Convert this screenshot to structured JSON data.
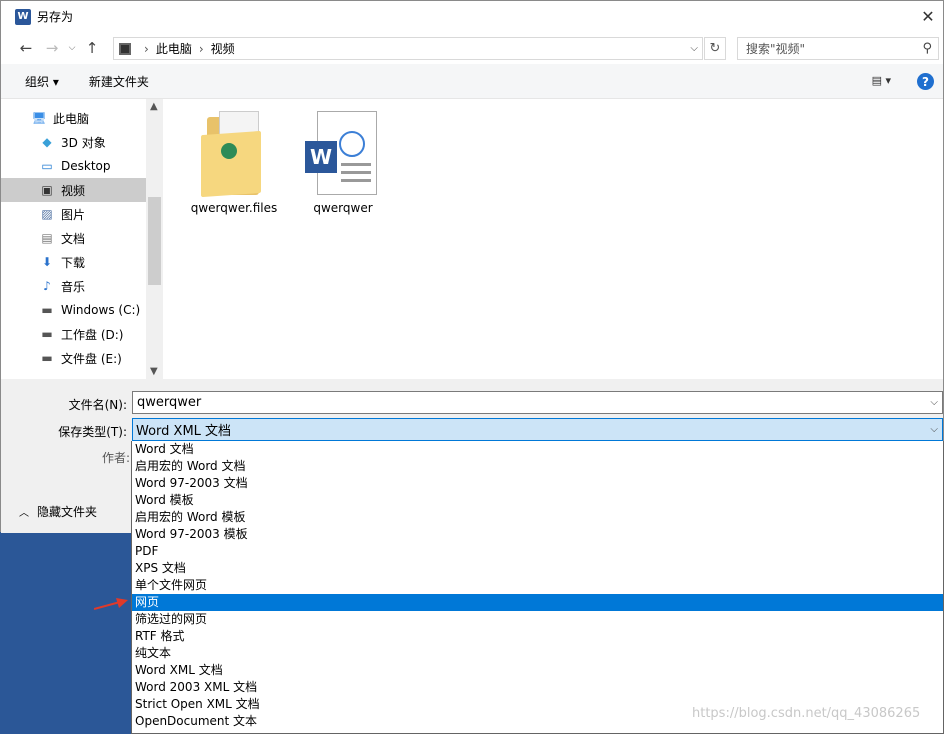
{
  "window": {
    "title": "另存为",
    "app_icon": "W"
  },
  "address": {
    "path": [
      "此电脑",
      "视频"
    ],
    "search_placeholder": "搜索\"视频\""
  },
  "toolbar": {
    "organize": "组织 ▾",
    "new_folder": "新建文件夹"
  },
  "sidebar": {
    "items": [
      {
        "label": "此电脑",
        "icon": "computer-icon",
        "indent": false,
        "selected": false
      },
      {
        "label": "3D 对象",
        "icon": "cube-icon",
        "indent": true,
        "selected": false
      },
      {
        "label": "Desktop",
        "icon": "desktop-icon",
        "indent": true,
        "selected": false
      },
      {
        "label": "视频",
        "icon": "film-icon",
        "indent": true,
        "selected": true
      },
      {
        "label": "图片",
        "icon": "picture-icon",
        "indent": true,
        "selected": false
      },
      {
        "label": "文档",
        "icon": "document-icon",
        "indent": true,
        "selected": false
      },
      {
        "label": "下载",
        "icon": "download-icon",
        "indent": true,
        "selected": false
      },
      {
        "label": "音乐",
        "icon": "music-icon",
        "indent": true,
        "selected": false
      },
      {
        "label": "Windows  (C:)",
        "icon": "drive-icon",
        "indent": true,
        "selected": false
      },
      {
        "label": "工作盘 (D:)",
        "icon": "drive-icon",
        "indent": true,
        "selected": false
      },
      {
        "label": "文件盘 (E:)",
        "icon": "drive-icon",
        "indent": true,
        "selected": false
      }
    ]
  },
  "files": [
    {
      "name": "qwerqwer.files",
      "type": "folder"
    },
    {
      "name": "qwerqwer",
      "type": "word-doc"
    }
  ],
  "form": {
    "filename_label": "文件名(N):",
    "filename_value": "qwerqwer",
    "filetype_label": "保存类型(T):",
    "filetype_value": "Word XML 文档",
    "author_label": "作者:",
    "hide_folders": "隐藏文件夹"
  },
  "filetype_options": [
    "Word 文档",
    "启用宏的 Word 文档",
    "Word 97-2003 文档",
    "Word 模板",
    "启用宏的 Word 模板",
    "Word 97-2003 模板",
    "PDF",
    "XPS 文档",
    "单个文件网页",
    "网页",
    "筛选过的网页",
    "RTF 格式",
    "纯文本",
    "Word XML 文档",
    "Word 2003 XML 文档",
    "Strict Open XML 文档",
    "OpenDocument 文本"
  ],
  "selected_option": "网页",
  "watermark": "https://blog.csdn.net/qq_43086265"
}
